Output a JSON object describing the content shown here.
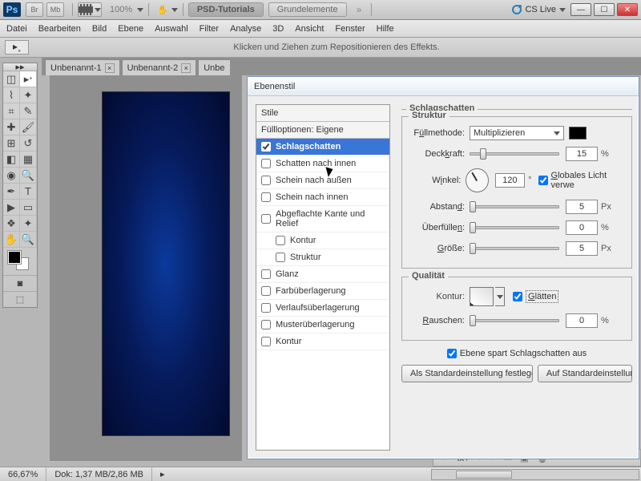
{
  "top": {
    "ps": "Ps",
    "br": "Br",
    "mb": "Mb",
    "zoom": "100%",
    "psd_tut": "PSD-Tutorials",
    "grundel": "Grundelemente",
    "cs_live": "CS Live"
  },
  "menu": [
    "Datei",
    "Bearbeiten",
    "Bild",
    "Ebene",
    "Auswahl",
    "Filter",
    "Analyse",
    "3D",
    "Ansicht",
    "Fenster",
    "Hilfe"
  ],
  "optbar": {
    "hint": "Klicken und Ziehen zum Repositionieren des Effekts."
  },
  "tabs": [
    {
      "label": "Unbenannt-1",
      "close": "×"
    },
    {
      "label": "Unbenannt-2",
      "close": "×"
    },
    {
      "label": "Unbe"
    }
  ],
  "status": {
    "zoom": "66,67%",
    "doc": "Dok: 1,37 MB/2,86 MB"
  },
  "dialog": {
    "title": "Ebenenstil",
    "styles_header": "Stile",
    "fill_options": "Füllloptionen: Eigene",
    "items": {
      "schlagschatten": "Schlagschatten",
      "schatten_innen": "Schatten nach innen",
      "schein_aussen": "Schein nach außen",
      "schein_innen": "Schein nach innen",
      "kante_relief": "Abgeflachte Kante und Relief",
      "kontur": "Kontur",
      "struktur": "Struktur",
      "glanz": "Glanz",
      "farbueberlagerung": "Farbüberlagerung",
      "verlaufsueberlagerung": "Verlaufsüberlagerung",
      "musterueberlagerung": "Musterüberlagerung",
      "kontur2": "Kontur"
    },
    "panel": {
      "group_title": "Schlagschatten",
      "struktur_title": "Struktur",
      "fuellmethode_label": "Füllmethode:",
      "fuellmethode_value": "Multiplizieren",
      "deckkraft_label": "Deckkraft:",
      "deckkraft_value": "15",
      "percent": "%",
      "winkel_label": "Winkel:",
      "winkel_value": "120",
      "winkel_unit": "°",
      "globales_licht": "Globales Licht verwe",
      "abstand_label": "Abstand:",
      "abstand_value": "5",
      "abstand_unit": "Px",
      "ueberfuellen_label": "Überfüllen:",
      "ueberfuellen_value": "0",
      "groesse_label": "Größe:",
      "groesse_value": "5",
      "groesse_unit": "Px",
      "qualitaet_title": "Qualität",
      "kontur_label": "Kontur:",
      "glaetten": "Glätten",
      "rauschen_label": "Rauschen:",
      "rauschen_value": "0",
      "aussparen": "Ebene spart Schlagschatten aus",
      "btn_default_set": "Als Standardeinstellung festlegen",
      "btn_default_reset": "Auf Standardeinstellun"
    }
  },
  "layerbar": {
    "fx": "fx"
  }
}
